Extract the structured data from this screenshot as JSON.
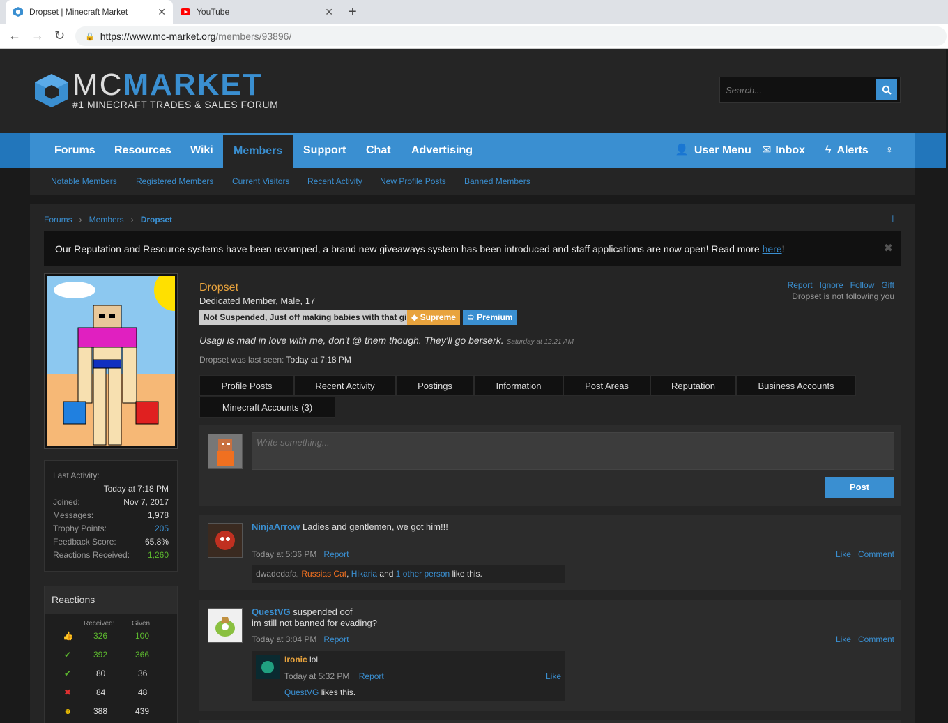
{
  "browser": {
    "tabs": [
      {
        "title": "Dropset | Minecraft Market",
        "active": true
      },
      {
        "title": "YouTube",
        "active": false
      }
    ],
    "url_host": "https://www.mc-market.org",
    "url_path": "/members/93896/"
  },
  "header": {
    "logo_mc": "MC",
    "logo_market": "MARKET",
    "logo_sub": "#1 MINECRAFT TRADES & SALES FORUM",
    "search_placeholder": "Search..."
  },
  "nav": {
    "items": [
      "Forums",
      "Resources",
      "Wiki",
      "Members",
      "Support",
      "Chat",
      "Advertising"
    ],
    "active": "Members",
    "right": [
      "User Menu",
      "Inbox",
      "Alerts"
    ]
  },
  "subnav": [
    "Notable Members",
    "Registered Members",
    "Current Visitors",
    "Recent Activity",
    "New Profile Posts",
    "Banned Members"
  ],
  "breadcrumb": [
    "Forums",
    "Members",
    "Dropset"
  ],
  "notice": {
    "text": "Our Reputation and Resource systems have been revamped, a brand new giveaways system has been introduced and staff applications are now open! Read more ",
    "link": "here",
    "end": "!"
  },
  "stats": {
    "last_activity_label": "Last Activity:",
    "last_activity": "Today at 7:18 PM",
    "rows": [
      {
        "label": "Joined:",
        "value": "Nov 7, 2017"
      },
      {
        "label": "Messages:",
        "value": "1,978"
      },
      {
        "label": "Trophy Points:",
        "value": "205"
      },
      {
        "label": "Feedback Score:",
        "value": "65.8%"
      },
      {
        "label": "Reactions Received:",
        "value": "1,260"
      }
    ]
  },
  "reactions": {
    "title": "Reactions",
    "received_label": "Received:",
    "given_label": "Given:",
    "rows": [
      {
        "received": "326",
        "given": "100"
      },
      {
        "received": "392",
        "given": "366"
      },
      {
        "received": "80",
        "given": "36"
      },
      {
        "received": "84",
        "given": "48"
      },
      {
        "received": "388",
        "given": "439"
      }
    ]
  },
  "profile": {
    "name": "Dropset",
    "title": "Dedicated Member, Male, 17",
    "badges": [
      "Not Suspended, Just off making babies with that girl",
      "Supreme",
      "Premium"
    ],
    "links": [
      "Report",
      "Ignore",
      "Follow",
      "Gift"
    ],
    "follow_status": "Dropset is not following you",
    "status": "Usagi is mad in love with me, don't @ them though. They'll go berserk.",
    "status_time": "Saturday at 12:21 AM",
    "last_seen_label": "Dropset was last seen:",
    "last_seen": "Today at 7:18 PM",
    "tabs": [
      "Profile Posts",
      "Recent Activity",
      "Postings",
      "Information",
      "Post Areas",
      "Reputation",
      "Business Accounts",
      "Minecraft Accounts (3)"
    ]
  },
  "writer": {
    "placeholder": "Write something...",
    "button": "Post"
  },
  "posts": [
    {
      "author": "NinjaArrow",
      "text": "Ladies and gentlemen, we got him!!!",
      "time": "Today at 5:36 PM",
      "report": "Report",
      "like": "Like",
      "comment": "Comment",
      "likers": {
        "u1": "dwadedafa",
        "u2": "Russias Cat",
        "u3": "Hikaria",
        "and": " and ",
        "other": "1 other person",
        "tail": " like this."
      }
    },
    {
      "author": "QuestVG",
      "text": "suspended oof",
      "text2": "im still not banned for evading?",
      "time": "Today at 3:04 PM",
      "report": "Report",
      "like": "Like",
      "comment": "Comment",
      "reply": {
        "author": "Ironic",
        "text": "lol",
        "time": "Today at 5:32 PM",
        "report": "Report",
        "like": "Like",
        "liker": "QuestVG",
        "likes_tail": " likes this."
      }
    }
  ],
  "colors": {
    "accent": "#3a8fd1",
    "name": "#e8a33d",
    "green": "#5cb82e"
  }
}
